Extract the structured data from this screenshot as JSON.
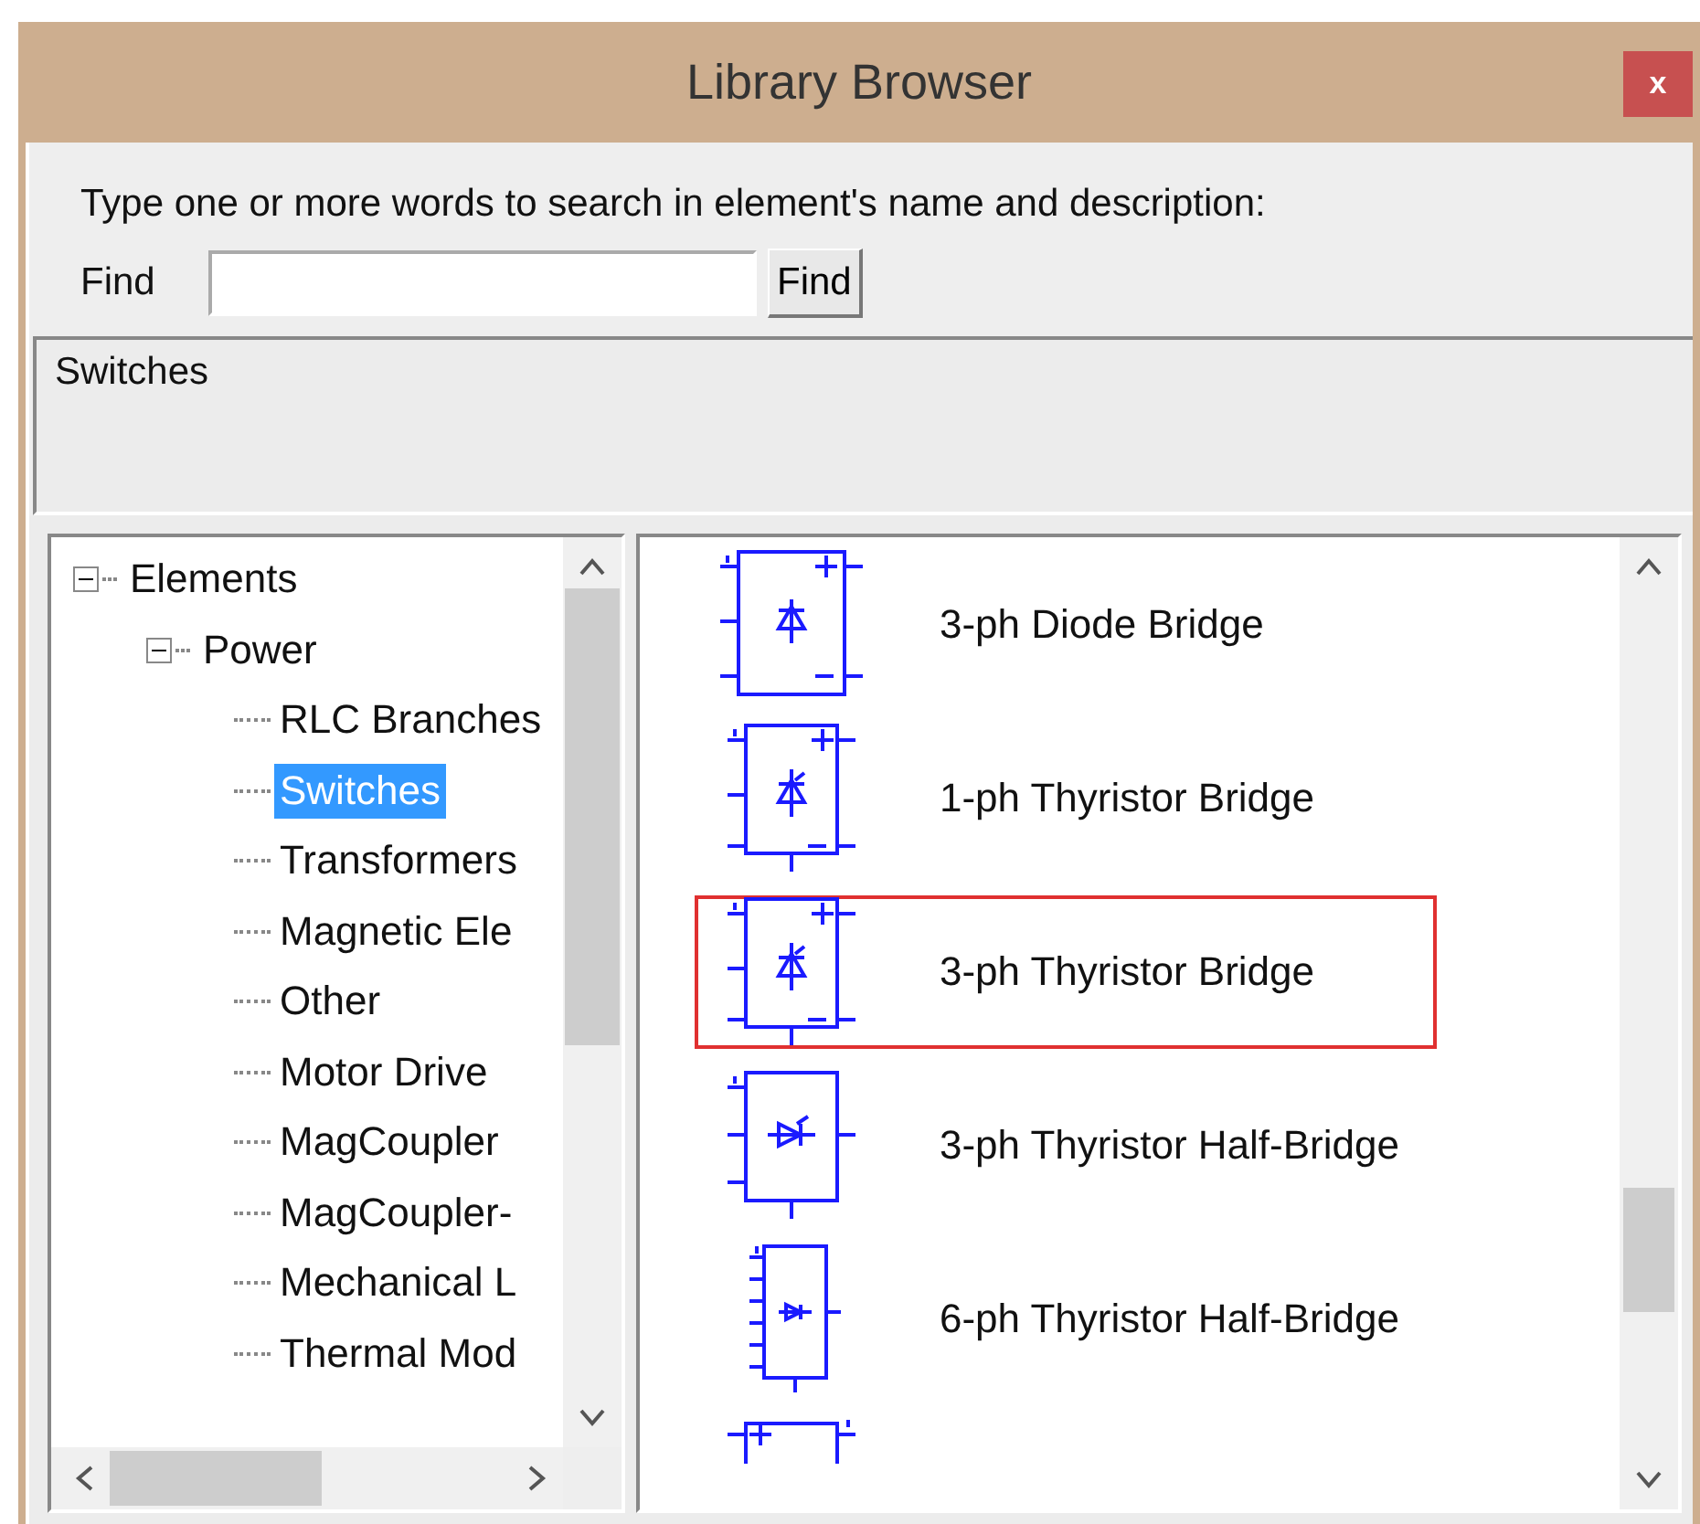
{
  "window": {
    "title": "Library Browser",
    "close_label": "x"
  },
  "search": {
    "prompt": "Type one or more words to search in element's name and  description:",
    "find_label": "Find",
    "button": "Find"
  },
  "description": "Switches",
  "tree": [
    {
      "label": "Elements",
      "expanded": true,
      "selected": false,
      "children": [
        {
          "label": "Power",
          "expanded": true,
          "selected": false,
          "children": [
            {
              "label": "RLC Branches",
              "selected": false
            },
            {
              "label": "Switches",
              "selected": true
            },
            {
              "label": "Transformers",
              "selected": false
            },
            {
              "label": "Magnetic Ele",
              "selected": false
            },
            {
              "label": "Other",
              "selected": false
            },
            {
              "label": "Motor Drive",
              "selected": false
            },
            {
              "label": "MagCoupler",
              "selected": false
            },
            {
              "label": "MagCoupler-",
              "selected": false
            },
            {
              "label": "Mechanical L",
              "selected": false
            },
            {
              "label": "Thermal Mod",
              "selected": false
            }
          ]
        }
      ]
    }
  ],
  "elements": [
    {
      "kind": "diode-bridge",
      "label": "3-ph Diode Bridge",
      "highlighted": false
    },
    {
      "kind": "thyristor-bridge",
      "label": "1-ph Thyristor Bridge",
      "highlighted": false
    },
    {
      "kind": "thyristor-bridge",
      "label": "3-ph Thyristor Bridge",
      "highlighted": true
    },
    {
      "kind": "half-bridge",
      "label": "3-ph Thyristor Half-Bridge",
      "highlighted": false
    },
    {
      "kind": "six-half-bridge",
      "label": "6-ph Thyristor Half-Bridge",
      "highlighted": false
    },
    {
      "kind": "partial"
    }
  ]
}
